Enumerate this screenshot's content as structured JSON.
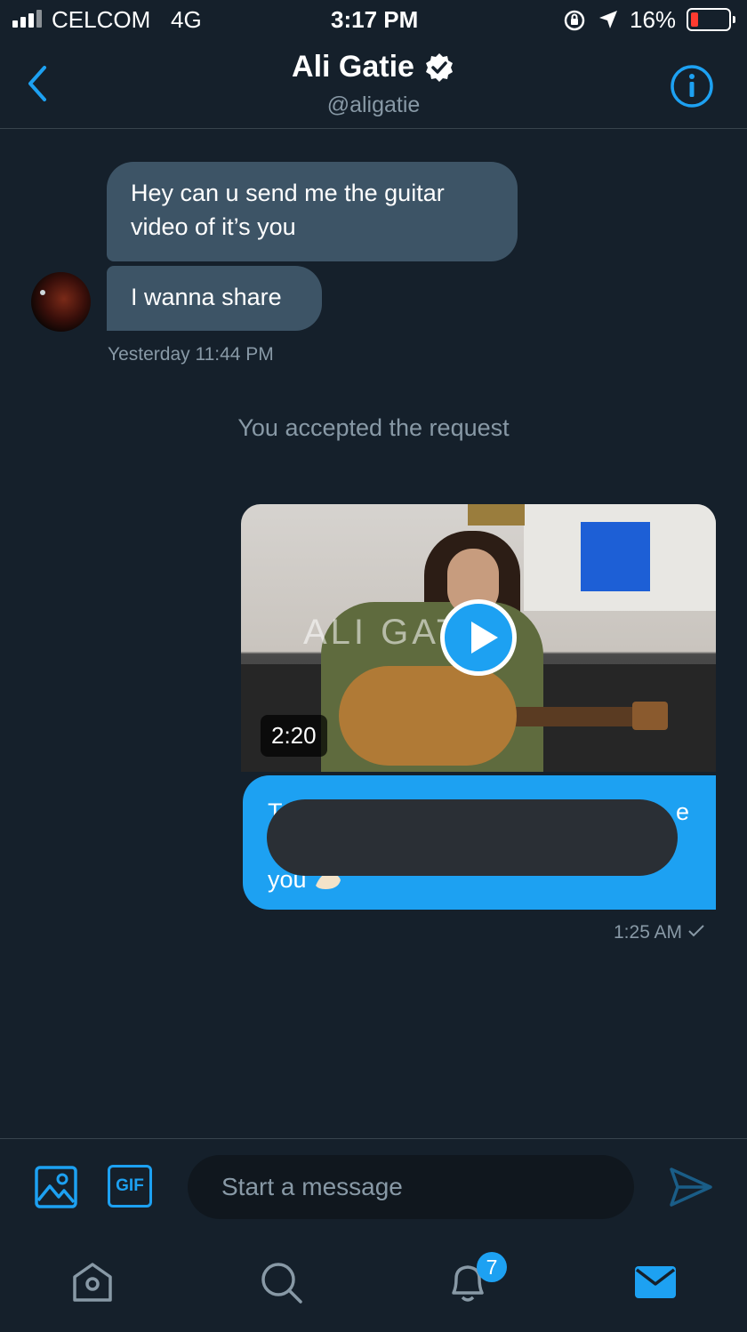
{
  "status_bar": {
    "carrier": "CELCOM",
    "network": "4G",
    "time": "3:17 PM",
    "battery_percent": "16%",
    "battery_level": 0.16
  },
  "header": {
    "name": "Ali Gatie",
    "handle": "@aligatie",
    "verified": true,
    "icons": [
      "back-icon",
      "verified-icon",
      "info-icon"
    ]
  },
  "messages": {
    "incoming": [
      {
        "line1": "Hey can u send me the guitar",
        "line2": "video of it’s you"
      },
      {
        "text": "I wanna share"
      }
    ],
    "incoming_timestamp": "Yesterday 11:44 PM",
    "system_notice": "You accepted the request",
    "video": {
      "watermark": "ALI GAT",
      "duration": "2:20"
    },
    "outgoing": {
      "visible_start": "T",
      "visible_end": "e",
      "visible_last": "you"
    },
    "outgoing_timestamp": "1:25 AM"
  },
  "composer": {
    "placeholder": "Start a message",
    "gif_label": "GIF"
  },
  "tabbar": {
    "notifications_badge": "7",
    "items": [
      "home-icon",
      "search-icon",
      "notifications-icon",
      "messages-icon"
    ]
  },
  "colors": {
    "background": "#15202b",
    "accent": "#1da1f2",
    "incoming_bubble": "#3d5466",
    "muted_text": "#8899a6"
  }
}
